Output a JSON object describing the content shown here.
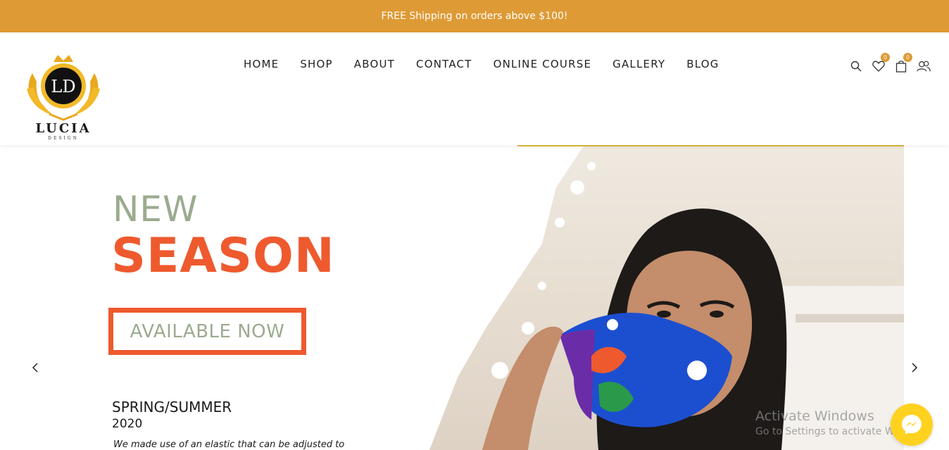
{
  "topbar": {
    "message": "FREE Shipping on orders above $100!"
  },
  "brand": {
    "monogram": "LD",
    "name": "LUCIA",
    "tagline": "DESIGN"
  },
  "nav": [
    "HOME",
    "SHOP",
    "ABOUT",
    "CONTACT",
    "ONLINE COURSE",
    "GALLERY",
    "BLOG"
  ],
  "header_icons": {
    "search": "search-icon",
    "wishlist": "heart-icon",
    "wishlist_count": "0",
    "cart": "bag-icon",
    "cart_count": "0",
    "account": "users-icon"
  },
  "hero": {
    "line1": "NEW",
    "line2": "SEASON",
    "cta": "AVAILABLE NOW",
    "collection": "SPRING/SUMMER",
    "year": "2020",
    "description": "We made use of an elastic that can be adjusted to"
  },
  "watermark": {
    "title": "Activate Windows",
    "subtitle": "Go to Settings to activate Windows."
  },
  "colors": {
    "accent": "#de9a35",
    "orange": "#ee5a2e",
    "sage": "#9bab8f",
    "messenger": "#ffd21f"
  }
}
